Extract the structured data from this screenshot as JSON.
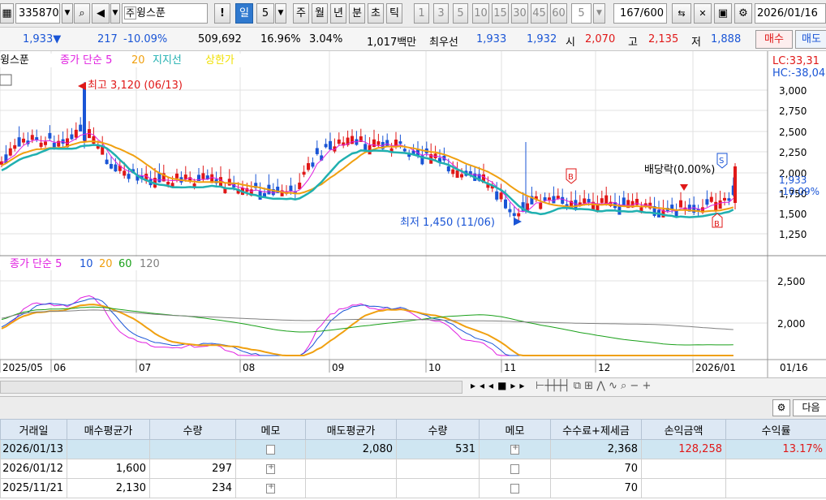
{
  "toolbar": {
    "code": "335870",
    "stock_name": "윙스푼",
    "stock_badge": "주",
    "excl": "!",
    "period_sel": "일",
    "period_num": "5",
    "periods": [
      "주",
      "월",
      "년",
      "분",
      "초",
      "틱"
    ],
    "minutes": [
      "1",
      "3",
      "5",
      "10",
      "15",
      "30",
      "45",
      "60"
    ],
    "interval": "5",
    "count": "167/600",
    "date": "2026/01/16"
  },
  "quote": {
    "price": "1,933",
    "change": "217",
    "rate": "-10.09%",
    "volume": "509,692",
    "turnover_rate": "16.96%",
    "ratio": "3.04%",
    "amount": "1,017백만",
    "best_label": "최우선",
    "best_ask": "1,933",
    "best_bid": "1,932",
    "open_label": "시",
    "open": "2,070",
    "high_label": "고",
    "high": "2,135",
    "low_label": "저",
    "low": "1,888",
    "buy_btn": "매수",
    "sell_btn": "매도"
  },
  "price_legend": {
    "name": "윙스푼",
    "a": "종가 단순 5",
    "b": "20",
    "c": "지지선",
    "d": "상한가"
  },
  "price_axis": [
    "3,000",
    "2,750",
    "2,500",
    "2,250",
    "2,000",
    "1,750",
    "1,500",
    "1,250"
  ],
  "lc": "LC:33,31",
  "hc": "HC:-38,04",
  "cur_price": "1,933",
  "cur_rate": "-10.09%",
  "annotations": {
    "high": "최고 3,120 (06/13)",
    "low": "최저 1,450 (11/06)",
    "div": "배당락(0.00%)",
    "b": "B",
    "s": "S"
  },
  "ma_legend": {
    "a": "종가 단순 5",
    "b": "10",
    "c": "20",
    "d": "60",
    "e": "120"
  },
  "ma_axis": [
    "2,500",
    "2,000"
  ],
  "x_labels": [
    "2025/05",
    "06",
    "07",
    "08",
    "09",
    "10",
    "11",
    "12",
    "2026/01",
    "01/16"
  ],
  "panel": {
    "next": "다음"
  },
  "table": {
    "headers": [
      "거래일",
      "매수평균가",
      "수량",
      "메모",
      "매도평균가",
      "수량",
      "메모",
      "수수료+제세금",
      "손익금액",
      "수익률"
    ],
    "rows": [
      [
        "2026/01/13",
        "",
        "",
        "",
        "2,080",
        "531",
        "",
        "2,368",
        "128,258",
        "13.17%"
      ],
      [
        "2026/01/12",
        "1,600",
        "297",
        "",
        "",
        "",
        "",
        "70",
        "",
        ""
      ],
      [
        "2025/11/21",
        "2,130",
        "234",
        "",
        "",
        "",
        "",
        "70",
        "",
        ""
      ]
    ]
  },
  "colors": {
    "up": "#e01818",
    "down": "#1a55d6",
    "ma5": "#e01ee0",
    "ma20": "#f0a010",
    "support": "#20b0b0",
    "ma60": "#1aa01a",
    "ma120": "#808080"
  }
}
